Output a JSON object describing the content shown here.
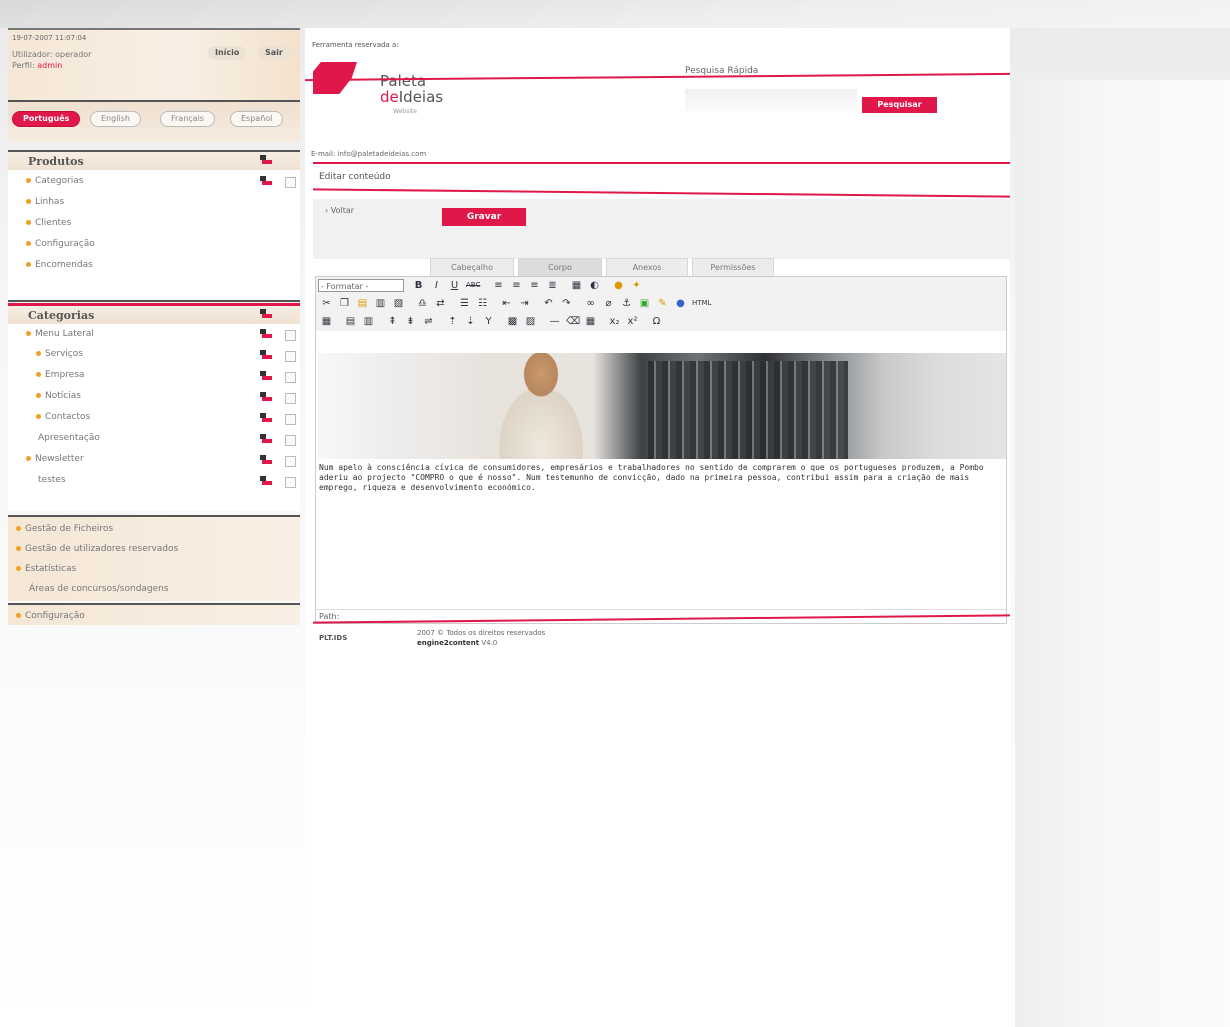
{
  "session": {
    "datetime": "19-07-2007 11:07:04",
    "user_line": "Utilizador: operador",
    "perfil_label": "Perfil:",
    "perfil_value": "admin",
    "inicio": "Início",
    "sair": "Sair"
  },
  "languages": [
    "Português",
    "English",
    "Français",
    "Español"
  ],
  "produtos": {
    "title": "Produtos",
    "items": [
      "Categorias",
      "Linhas",
      "Clientes",
      "Configuração",
      "Encomendas"
    ]
  },
  "categorias": {
    "title": "Categorias",
    "items": [
      "Menu Lateral",
      "Serviços",
      "Empresa",
      "Notícias",
      "Contactos",
      "Apresentação",
      "Newsletter",
      "testes"
    ]
  },
  "bottom_menu": [
    "Gestão de Ficheiros",
    "Gestão de utilizadores reservados",
    "Estatísticas",
    "Áreas de concursos/sondagens"
  ],
  "config_menu": "Configuração",
  "header": {
    "access": "Ferramenta reservada a:",
    "logo_line1": "Paleta",
    "logo_line2_de": "de",
    "logo_line2_rest": "Ideias",
    "logo_sub": "Website",
    "email": "E-mail: info@paletadeideias.com",
    "search_label": "Pesquisa Rápida",
    "search_value": "",
    "search_button": "Pesquisar"
  },
  "page": {
    "title": "Editar conteúdo",
    "back": "› Voltar",
    "save": "Gravar",
    "tabs": [
      "Cabeçalho",
      "Corpo",
      "Anexos",
      "Permissões"
    ]
  },
  "editor": {
    "format_select": "- Formatar -",
    "body": "Num apelo à consciência cívica de consumidores, empresários e trabalhadores no sentido de comprarem o que os portugueses produzem, a Pombo aderiu ao projecto \"COMPRO o que é nosso\". Num testemunho de convicção, dado na primeira pessoa, contribui assim para a criação de mais emprego, riqueza e desenvolvimento económico.",
    "path": "Path:"
  },
  "footer": {
    "logo": "PLT.IDS",
    "copyright": "2007 © Todos os direitos reservados",
    "engine_name": "engine2content",
    "engine_version": "V4.0"
  },
  "colors": {
    "accent": "#e0184a",
    "sidebar": "#f5e7d6"
  }
}
